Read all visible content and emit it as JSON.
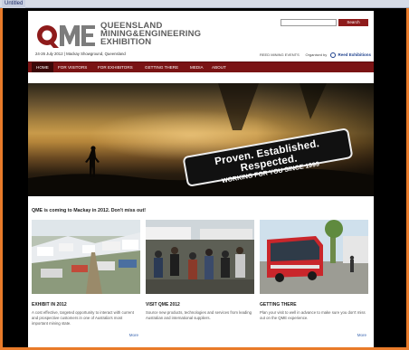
{
  "browser": {
    "tab_label": "Untitled"
  },
  "header": {
    "logo_letters": "QME",
    "logo_line1": "QUEENSLAND",
    "logo_line2": "MINING&ENGINEERING",
    "logo_line3": "EXHIBITION",
    "event_dates": "24-26 July 2012 | Mackay Showground, Queensland",
    "search_placeholder": "",
    "search_button": "Search",
    "sponsor_prefix": "REED MINING EVENTS",
    "sponsor_organised": "Organised by",
    "sponsor_name": "Reed Exhibitions"
  },
  "nav": {
    "items": [
      {
        "label": "HOME",
        "active": true
      },
      {
        "label": "FOR VISITORS"
      },
      {
        "label": "FOR EXHIBITORS"
      },
      {
        "label": "GETTING THERE"
      },
      {
        "label": "MEDIA"
      },
      {
        "label": "ABOUT"
      }
    ]
  },
  "hero": {
    "tagline": "Proven. Established. Respected.",
    "subline": "WORKING FOR YOU SINCE 1993"
  },
  "intro": "QME is coming to Mackay in 2012. Don't miss out!",
  "columns": [
    {
      "title": "EXHIBIT IN 2012",
      "text": "A cost effective, targeted opportunity to interact with current and prospective customers in one of Australia's most important mining state.",
      "more": "More"
    },
    {
      "title": "VISIT QME 2012",
      "text": "Source new products, technologies and services from leading Australian and international suppliers.",
      "more": ""
    },
    {
      "title": "GETTING THERE",
      "text": "Plan your visit to well in advance to make sure you don't miss out on the QME experience.",
      "more": "More"
    }
  ],
  "colors": {
    "brand_red": "#7a1314",
    "accent_orange": "#e97b2a",
    "logo_grey": "#5d5d5d"
  }
}
